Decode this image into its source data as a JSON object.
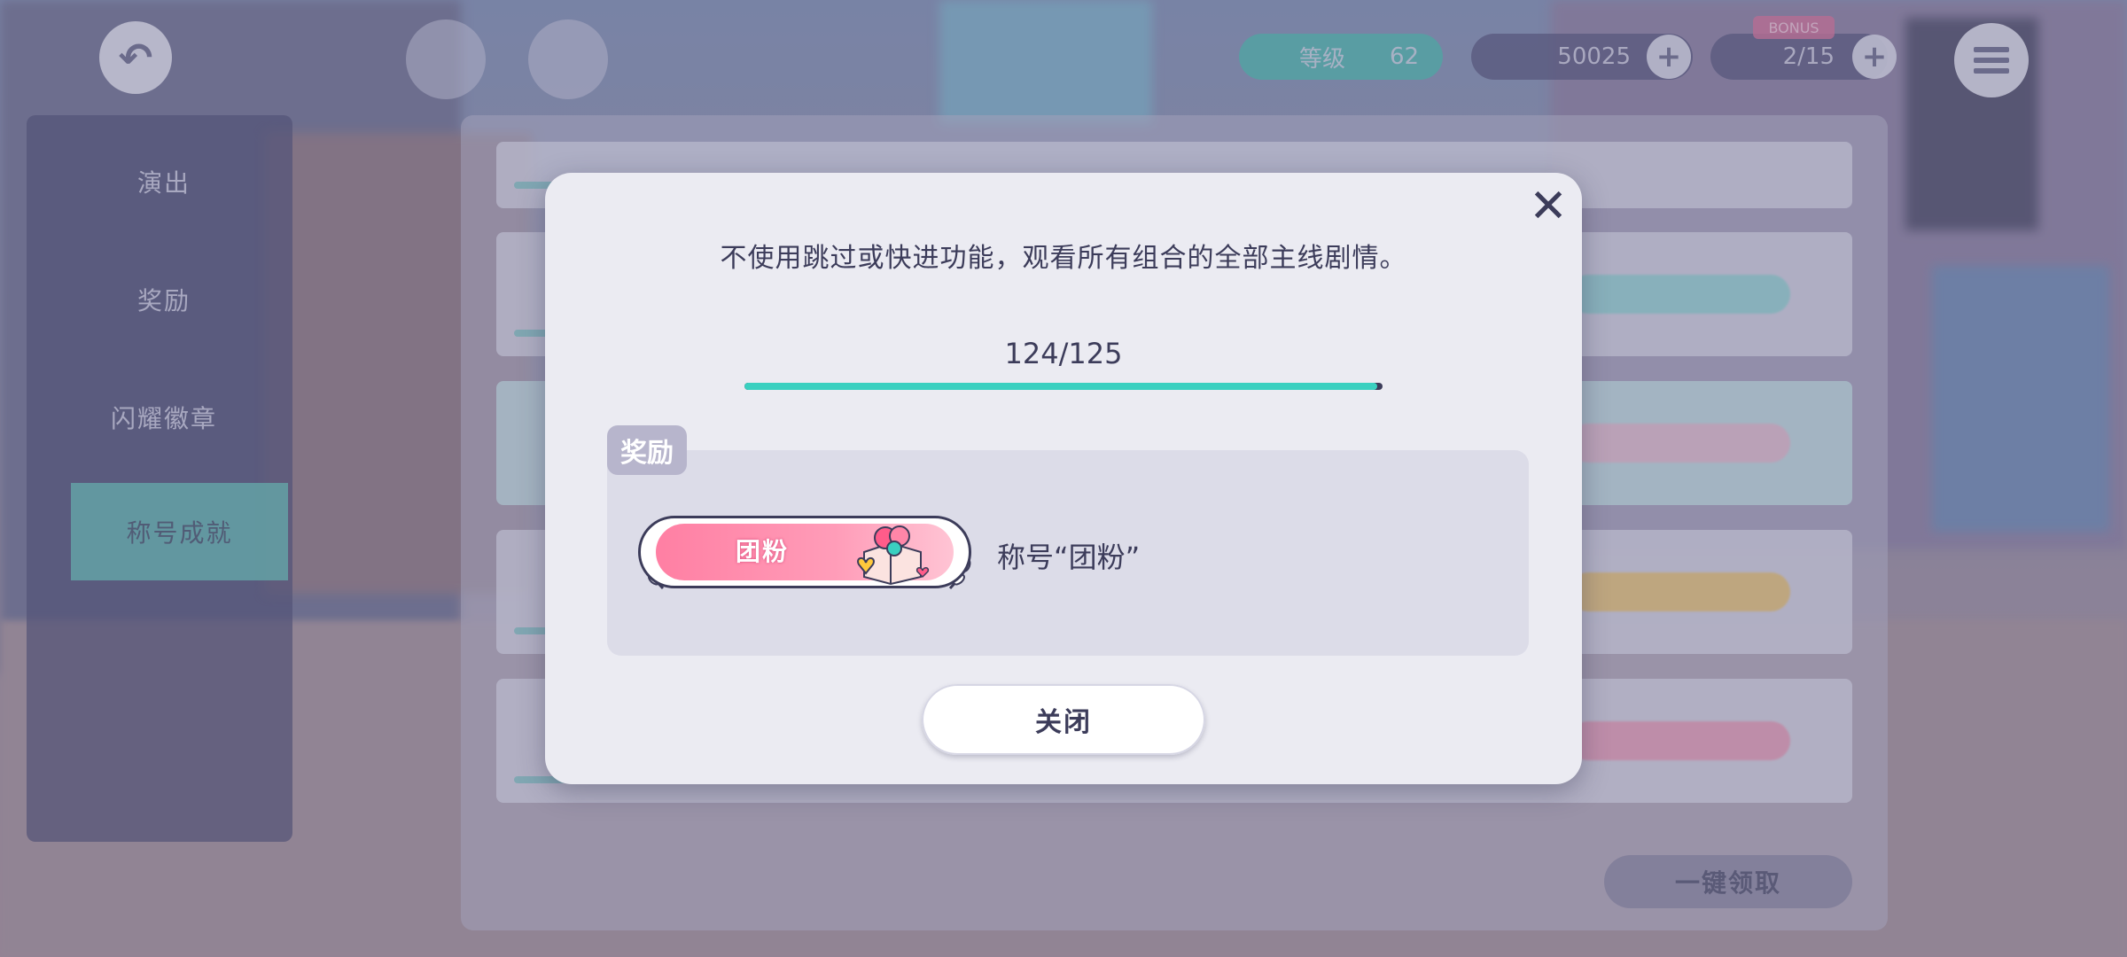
{
  "background_menu": {
    "side_tabs": [
      "演出",
      "奖励",
      "闪耀徽章",
      "称号成就"
    ],
    "active_tab_index": 3,
    "claim_all_label": "一键领取"
  },
  "hud": {
    "level_label": "等级",
    "level_value": "62",
    "coins": "50025",
    "tickets": "2/15",
    "ticket_tag": "BONUS"
  },
  "modal": {
    "description": "不使用跳过或快进功能，观看所有组合的全部主线剧情。",
    "progress": {
      "current": 124,
      "total": 125,
      "text": "124/125"
    },
    "reward_section_label": "奖励",
    "reward": {
      "badge_text": "团粉",
      "label": "称号“团粉”"
    },
    "close_button_label": "关闭"
  },
  "colors": {
    "progress_fill": "#3ad0c0",
    "text_dark": "#3c3c5a",
    "modal_bg": "#ebebf2",
    "badge_pink": "#ff7fa3"
  },
  "icons": {
    "back": "back-arrow-icon",
    "close": "close-icon",
    "menu": "hamburger-menu-icon",
    "add": "plus-icon",
    "gift": "gift-box-icon"
  }
}
